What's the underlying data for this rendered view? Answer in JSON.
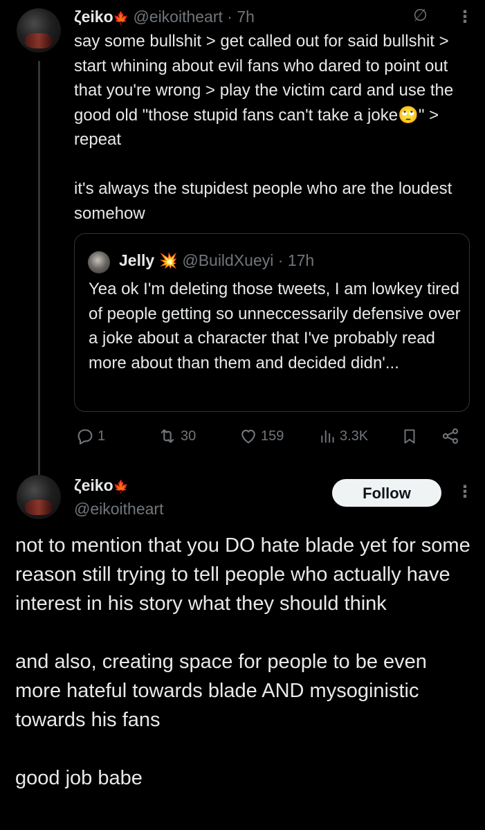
{
  "tweet": {
    "name": "ζeiko",
    "name_icon": "maple-leaf-icon",
    "handle": "@eikoitheart",
    "time": "· 7h",
    "text": "say some bullshit > get called out for said bullshit > start whining about evil fans who dared to point out that you're wrong > play the victim card and use the good old \"those stupid fans can't take a joke🙄\" > repeat\n\nit's always the stupidest people who are the loudest somehow"
  },
  "quote": {
    "name": "Jelly",
    "name_icon": "explosion-icon",
    "handle": "@BuildXueyi",
    "time": "· 17h",
    "text": "Yea ok I'm deleting those tweets, I am lowkey tired of people getting so unneccessarily defensive over a joke about a character that I've probably read more about than them and decided didn'..."
  },
  "actions": {
    "replies": "1",
    "reposts": "30",
    "likes": "159",
    "views": "3.3K"
  },
  "reply": {
    "name": "ζeiko",
    "handle": "@eikoitheart",
    "follow_label": "Follow",
    "text": "not to mention that you DO hate blade yet for some reason still trying to tell people who actually have interest in his story what they should think\n\nand also, creating space for people to be even more hateful towards blade AND mysoginistic towards his fans\n\ngood job babe"
  },
  "glyphs": {
    "leaf": "🍁",
    "burst": "💥",
    "more": "⋮",
    "grok": "∅"
  },
  "colors": {
    "background": "#000000",
    "text": "#e7e9ea",
    "muted": "#71767b",
    "border": "#2f3336",
    "follow_bg": "#eff3f4"
  }
}
